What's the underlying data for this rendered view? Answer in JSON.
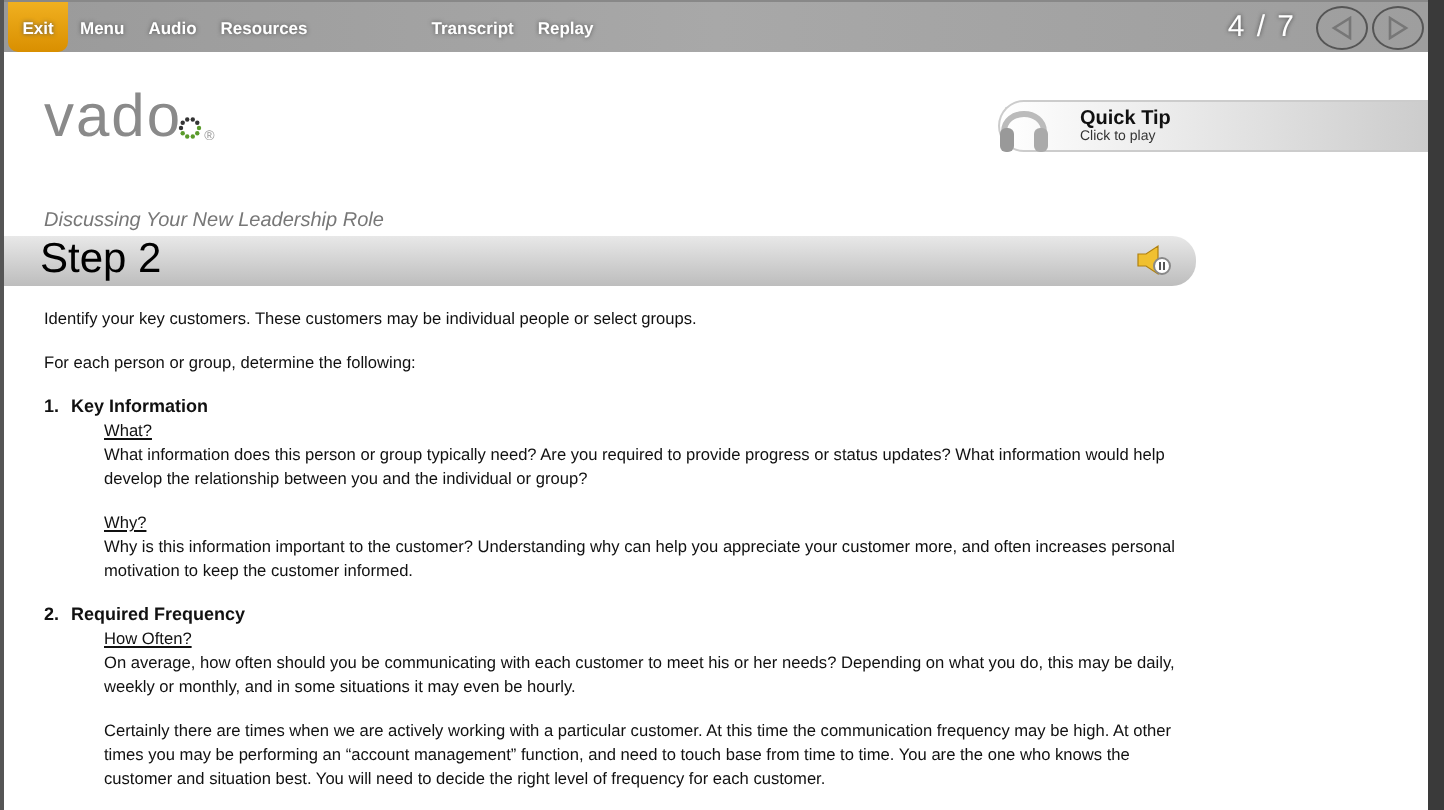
{
  "nav": {
    "items": [
      {
        "label": "Exit",
        "selected": true
      },
      {
        "label": "Menu",
        "selected": false
      },
      {
        "label": "Audio",
        "selected": false
      },
      {
        "label": "Resources",
        "selected": false
      },
      {
        "label": "Transcript",
        "selected": false
      },
      {
        "label": "Replay",
        "selected": false
      }
    ],
    "page_counter": "4 / 7"
  },
  "logo": {
    "text": "vado",
    "mark": "®"
  },
  "course_title": "Discussing Your New Leadership Role",
  "quick_tip": {
    "title": "Quick Tip",
    "subtitle": "Click to play"
  },
  "step_title": "Step 2",
  "intro": [
    [
      "Identify your key customers. These customers may be individual people or select groups."
    ],
    [
      "For each person or group, determine the following:"
    ]
  ],
  "sections": [
    {
      "number": "1.",
      "heading": "Key Information",
      "items": [
        {
          "question": "What?",
          "paragraphs": [
            [
              "What information does this person or group typically need? Are you required to provide progress or status updates? What information would help",
              "develop the relationship between you and the individual or group?"
            ]
          ]
        },
        {
          "question": "Why?",
          "paragraphs": [
            [
              "Why is this information important to the customer? Understanding why can help you appreciate your customer more, and often increases personal",
              "motivation to keep the customer informed."
            ]
          ]
        }
      ]
    },
    {
      "number": "2.",
      "heading": "Required Frequency",
      "items": [
        {
          "question": "How Often?",
          "paragraphs": [
            [
              "On average, how often should you be communicating with each customer to meet his or her needs? Depending on what you do, this may be daily,",
              "weekly or monthly, and in some situations it may even be hourly."
            ],
            [
              "Certainly there are times when we are actively working with a particular customer. At this time the communication frequency may be high. At other",
              "times you may be performing an “account management” function, and need to touch base from time to time. You are the one who knows the",
              "customer and situation best. You will need to decide the right level of frequency for each customer."
            ]
          ]
        }
      ]
    }
  ]
}
